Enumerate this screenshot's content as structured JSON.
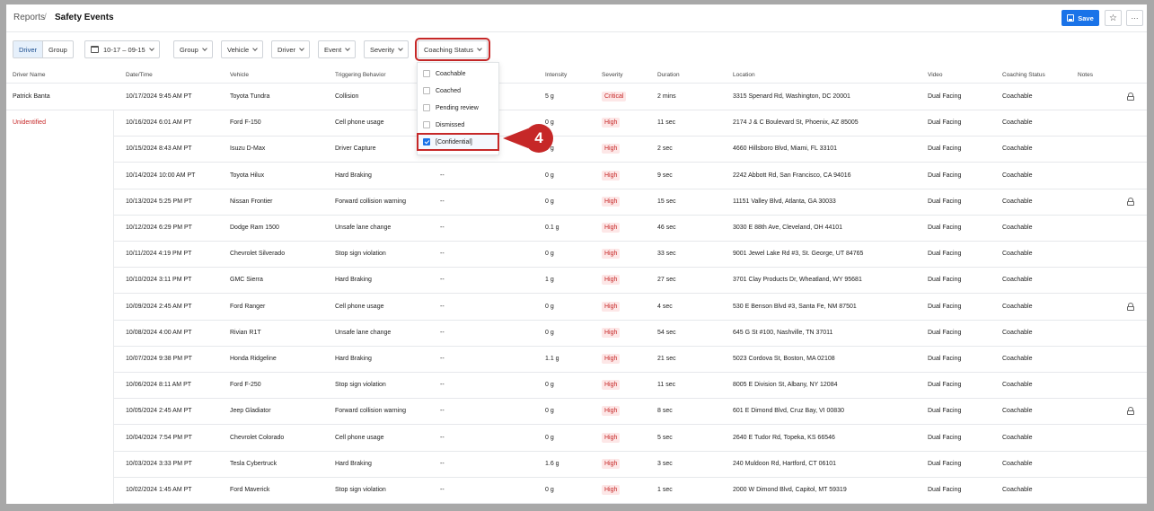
{
  "breadcrumb": {
    "root": "Reports",
    "separator": "/",
    "current": "Safety Events"
  },
  "header_actions": {
    "save_label": "Save",
    "star_icon": "☆",
    "more_icon": "···"
  },
  "filters": {
    "toggle": {
      "driver": "Driver",
      "group": "Group"
    },
    "date_range": "10-17 – 09-15",
    "group": "Group",
    "vehicle": "Vehicle",
    "driver": "Driver",
    "event": "Event",
    "severity": "Severity",
    "coaching_status": "Coaching Status"
  },
  "coaching_dropdown": {
    "options": [
      {
        "label": "Coachable",
        "checked": false
      },
      {
        "label": "Coached",
        "checked": false
      },
      {
        "label": "Pending review",
        "checked": false
      },
      {
        "label": "Dismissed",
        "checked": false
      },
      {
        "label": "[Confidential]",
        "checked": true
      }
    ]
  },
  "callout": {
    "step": "4"
  },
  "colors": {
    "accent": "#1a73e8",
    "highlight": "#c62828",
    "severity_text": "#c62828",
    "severity_bg": "#fde7e7"
  },
  "table": {
    "headers": {
      "driver": "Driver Name",
      "datetime": "Date/Time",
      "vehicle": "Vehicle",
      "behavior": "Triggering Behavior",
      "intensity": "Intensity",
      "severity": "Severity",
      "duration": "Duration",
      "location": "Location",
      "video": "Video",
      "coaching": "Coaching Status",
      "notes": "Notes"
    },
    "rows": [
      {
        "driver": "Patrick Banta",
        "datetime": "10/17/2024 9:45 AM PT",
        "vehicle": "Toyota Tundra",
        "behavior": "Collision",
        "extra": "",
        "intensity": "5 g",
        "severity": "Critical",
        "duration": "2 mins",
        "location": "3315 Spenard Rd, Washington, DC 20001",
        "video": "Dual Facing",
        "coaching": "Coachable",
        "locked": true
      },
      {
        "driver": "Unidentified",
        "datetime": "10/16/2024 6:01 AM PT",
        "vehicle": "Ford F-150",
        "behavior": "Cell phone usage",
        "extra": "",
        "intensity": "0 g",
        "severity": "High",
        "duration": "11 sec",
        "location": "2174 J & C Boulevard St, Phoenix, AZ 85005",
        "video": "Dual Facing",
        "coaching": "Coachable",
        "locked": false
      },
      {
        "driver": "",
        "datetime": "10/15/2024 8:43 AM PT",
        "vehicle": "Isuzu D-Max",
        "behavior": "Driver Capture",
        "extra": "",
        "intensity": "0 g",
        "severity": "High",
        "duration": "2 sec",
        "location": "4660 Hillsboro Blvd, Miami, FL 33101",
        "video": "Dual Facing",
        "coaching": "Coachable",
        "locked": false
      },
      {
        "driver": "",
        "datetime": "10/14/2024 10:00 AM PT",
        "vehicle": "Toyota Hilux",
        "behavior": "Hard Braking",
        "extra": "--",
        "intensity": "0 g",
        "severity": "High",
        "duration": "9 sec",
        "location": "2242 Abbott Rd, San Francisco, CA 94016",
        "video": "Dual Facing",
        "coaching": "Coachable",
        "locked": false
      },
      {
        "driver": "",
        "datetime": "10/13/2024 5:25 PM PT",
        "vehicle": "Nissan Frontier",
        "behavior": "Forward collision warning",
        "extra": "--",
        "intensity": "0 g",
        "severity": "High",
        "duration": "15 sec",
        "location": "11151 Valley Blvd, Atlanta, GA 30033",
        "video": "Dual Facing",
        "coaching": "Coachable",
        "locked": true
      },
      {
        "driver": "",
        "datetime": "10/12/2024 6:29 PM PT",
        "vehicle": "Dodge Ram 1500",
        "behavior": "Unsafe lane change",
        "extra": "--",
        "intensity": "0.1 g",
        "severity": "High",
        "duration": "46 sec",
        "location": "3030 E 88th Ave, Cleveland, OH 44101",
        "video": "Dual Facing",
        "coaching": "Coachable",
        "locked": false
      },
      {
        "driver": "",
        "datetime": "10/11/2024 4:19 PM PT",
        "vehicle": "Chevrolet Silverado",
        "behavior": "Stop sign violation",
        "extra": "--",
        "intensity": "0 g",
        "severity": "High",
        "duration": "33 sec",
        "location": "9001 Jewel Lake Rd #3, St. George, UT 84765",
        "video": "Dual Facing",
        "coaching": "Coachable",
        "locked": false
      },
      {
        "driver": "",
        "datetime": "10/10/2024 3:11 PM PT",
        "vehicle": "GMC Sierra",
        "behavior": "Hard Braking",
        "extra": "--",
        "intensity": "1 g",
        "severity": "High",
        "duration": "27 sec",
        "location": "3701 Clay Products Dr, Wheatland, WY 95681",
        "video": "Dual Facing",
        "coaching": "Coachable",
        "locked": false
      },
      {
        "driver": "",
        "datetime": "10/09/2024 2:45 AM PT",
        "vehicle": "Ford Ranger",
        "behavior": "Cell phone usage",
        "extra": "--",
        "intensity": "0 g",
        "severity": "High",
        "duration": "4 sec",
        "location": "530 E Benson Blvd #3, Santa Fe, NM 87501",
        "video": "Dual Facing",
        "coaching": "Coachable",
        "locked": true
      },
      {
        "driver": "",
        "datetime": "10/08/2024 4:00 AM PT",
        "vehicle": "Rivian R1T",
        "behavior": "Unsafe lane change",
        "extra": "--",
        "intensity": "0 g",
        "severity": "High",
        "duration": "54 sec",
        "location": "645 G St #100, Nashville, TN 37011",
        "video": "Dual Facing",
        "coaching": "Coachable",
        "locked": false
      },
      {
        "driver": "",
        "datetime": "10/07/2024 9:38 PM PT",
        "vehicle": "Honda Ridgeline",
        "behavior": "Hard Braking",
        "extra": "--",
        "intensity": "1.1 g",
        "severity": "High",
        "duration": "21 sec",
        "location": "5023 Cordova St, Boston, MA 02108",
        "video": "Dual Facing",
        "coaching": "Coachable",
        "locked": false
      },
      {
        "driver": "",
        "datetime": "10/06/2024 8:11 AM PT",
        "vehicle": "Ford F-250",
        "behavior": "Stop sign violation",
        "extra": "--",
        "intensity": "0 g",
        "severity": "High",
        "duration": "11 sec",
        "location": "8005 E Division St, Albany, NY 12084",
        "video": "Dual Facing",
        "coaching": "Coachable",
        "locked": false
      },
      {
        "driver": "",
        "datetime": "10/05/2024 2:45 AM PT",
        "vehicle": "Jeep Gladiator",
        "behavior": "Forward collision warning",
        "extra": "--",
        "intensity": "0 g",
        "severity": "High",
        "duration": "8 sec",
        "location": "601 E Dimond Blvd, Cruz Bay, VI 00830",
        "video": "Dual Facing",
        "coaching": "Coachable",
        "locked": true
      },
      {
        "driver": "",
        "datetime": "10/04/2024 7:54 PM PT",
        "vehicle": "Chevrolet Colorado",
        "behavior": "Cell phone usage",
        "extra": "--",
        "intensity": "0 g",
        "severity": "High",
        "duration": "5 sec",
        "location": "2640 E Tudor Rd, Topeka, KS 66546",
        "video": "Dual Facing",
        "coaching": "Coachable",
        "locked": false
      },
      {
        "driver": "",
        "datetime": "10/03/2024 3:33 PM PT",
        "vehicle": "Tesla Cybertruck",
        "behavior": "Hard Braking",
        "extra": "--",
        "intensity": "1.6 g",
        "severity": "High",
        "duration": "3 sec",
        "location": "240 Muldoon Rd, Hartford, CT 06101",
        "video": "Dual Facing",
        "coaching": "Coachable",
        "locked": false
      },
      {
        "driver": "",
        "datetime": "10/02/2024 1:45 AM PT",
        "vehicle": "Ford Maverick",
        "behavior": "Stop sign violation",
        "extra": "--",
        "intensity": "0 g",
        "severity": "High",
        "duration": "1 sec",
        "location": "2000 W Dimond Blvd, Capitol, MT 59319",
        "video": "Dual Facing",
        "coaching": "Coachable",
        "locked": false
      }
    ]
  }
}
